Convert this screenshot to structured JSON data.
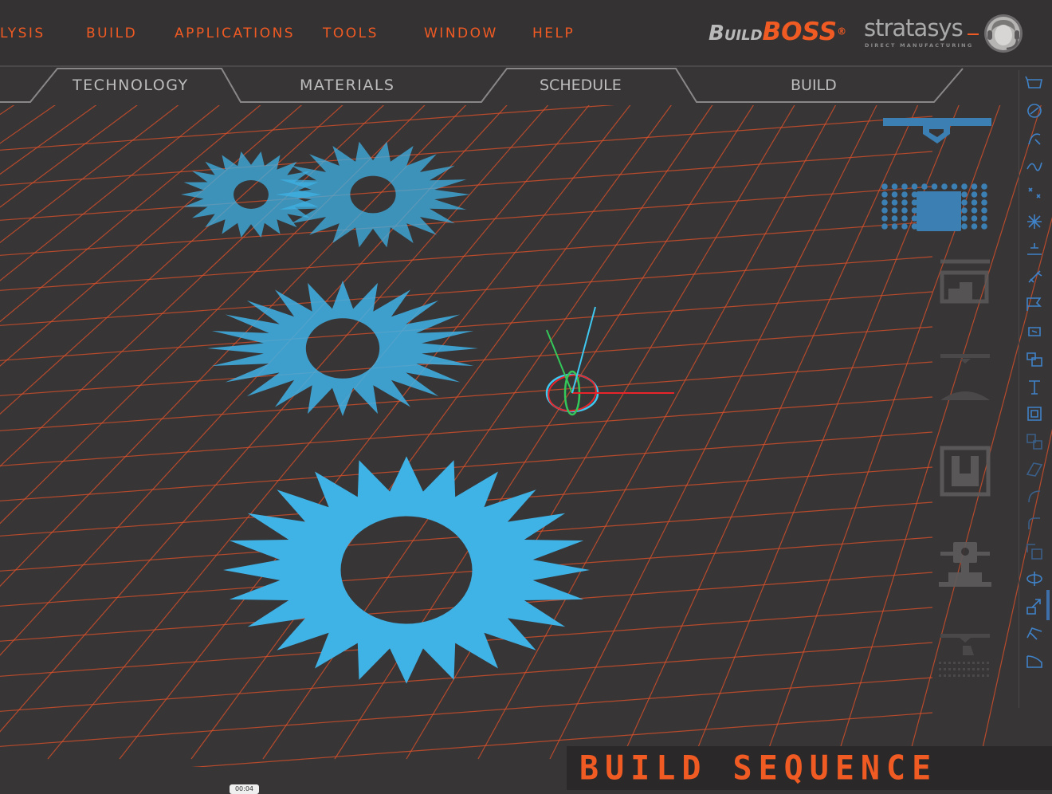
{
  "menu": {
    "items": [
      {
        "label": "LYSIS"
      },
      {
        "label": "BUILD"
      },
      {
        "label": "APPLICATIONS"
      },
      {
        "label": "TOOLS"
      },
      {
        "label": "WINDOW"
      },
      {
        "label": "HELP"
      }
    ]
  },
  "brand": {
    "product_prefix": "Build",
    "product_name": "BOSS",
    "registered": "®",
    "company": "stratasys",
    "company_tagline": "DIRECT MANUFACTURING"
  },
  "tabs": [
    {
      "label": "TECHNOLOGY"
    },
    {
      "label": "MATERIALS"
    },
    {
      "label": "SCHEDULE"
    },
    {
      "label": "BUILD"
    }
  ],
  "viewport": {
    "grid_color": "#e0512a",
    "part_color": "#3fb2e6",
    "parts": [
      "gear-part",
      "gear-part",
      "gear-part",
      "gear-part"
    ],
    "gizmo": {
      "x_axis_color": "#e8242a",
      "y_axis_color": "#34c759",
      "z_axis_color": "#3fc8f0"
    }
  },
  "process_steps": [
    "print-head",
    "support-layer",
    "tray-build",
    "dome-layer",
    "part-cavity",
    "jetting-unit",
    "layer-grid"
  ],
  "tool_rail": {
    "icons": [
      "tray-icon",
      "circle-sketch-icon",
      "curve-icon",
      "spline-icon",
      "points-icon",
      "star-points-icon",
      "dimension-icon",
      "pencil-icon",
      "flag-icon",
      "move-icon",
      "arrange-icon",
      "trim-icon",
      "frame-icon",
      "duplicate-icon",
      "surface-icon",
      "arc-icon",
      "fillet-icon",
      "scale-icon",
      "rotate-icon",
      "extrude-icon",
      "sweep-icon",
      "shell-icon"
    ]
  },
  "footer": {
    "sequence_label": "BUILD SEQUENCE",
    "timestamp": "00:04"
  },
  "colors": {
    "accent": "#f05a23",
    "background": "#383536",
    "part_blue": "#3fb2e6"
  }
}
